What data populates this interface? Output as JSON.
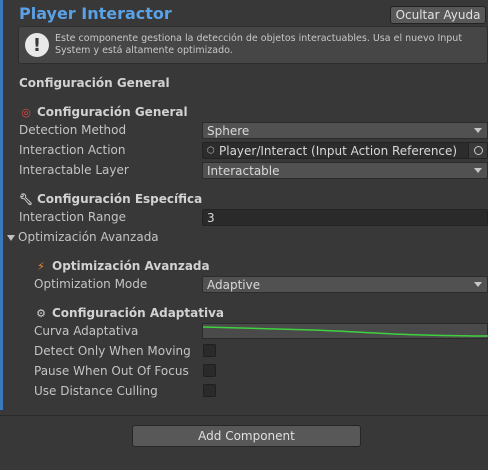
{
  "header": {
    "title": "Player Interactor",
    "help_button": "Ocultar Ayuda"
  },
  "help": {
    "icon": "warning-icon",
    "text": "Este componente gestiona la detección de objetos interactuables. Usa el nuevo Input System y está altamente optimizado."
  },
  "general": {
    "heading": "Configuración General",
    "subheading": "Configuración General",
    "icon": "target-icon",
    "detection_method_label": "Detection Method",
    "detection_method_value": "Sphere",
    "interaction_action_label": "Interaction Action",
    "interaction_action_value": "Player/Interact (Input Action Reference)",
    "interactable_layer_label": "Interactable Layer",
    "interactable_layer_value": "Interactable"
  },
  "specific": {
    "heading": "Configuración Específica",
    "icon": "wrench-icon",
    "range_label": "Interaction Range",
    "range_value": "3"
  },
  "optimization": {
    "foldout": "Optimización Avanzada",
    "heading": "Optimización Avanzada",
    "icon": "lightning-icon",
    "mode_label": "Optimization Mode",
    "mode_value": "Adaptive"
  },
  "adaptive": {
    "heading": "Configuración Adaptativa",
    "icon": "gear-icon",
    "curve_label": "Curva Adaptativa",
    "curve_color": "#3fd13f",
    "detect_moving_label": "Detect Only When Moving",
    "detect_moving_checked": false,
    "pause_focus_label": "Pause When Out Of Focus",
    "pause_focus_checked": false,
    "distance_culling_label": "Use Distance Culling",
    "distance_culling_checked": false
  },
  "footer": {
    "add_component": "Add Component"
  }
}
